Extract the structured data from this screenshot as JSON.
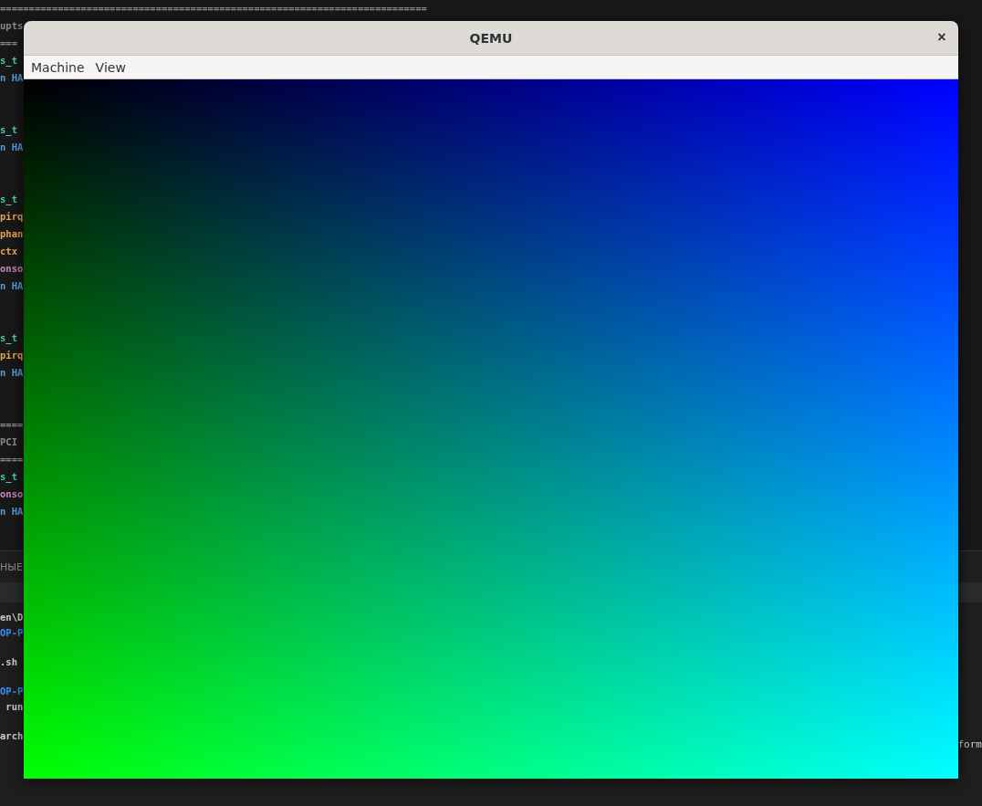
{
  "editor": {
    "groups": [
      [
        {
          "text": "==========================================================================",
          "color": "#8a8a8a"
        },
        {
          "text": "upts",
          "color": "#8a8a8a"
        },
        {
          "text": "===",
          "color": "#8a8a8a"
        },
        {
          "text": "s_t",
          "color": "#4ec9b0"
        },
        {
          "text": "n HA",
          "color": "#569cd6"
        }
      ],
      [
        {
          "text": "s_t",
          "color": "#4ec9b0"
        },
        {
          "text": "n HA",
          "color": "#569cd6"
        }
      ],
      [
        {
          "text": "s_t",
          "color": "#4ec9b0"
        },
        {
          "text": "pirq",
          "color": "#e5a15a"
        },
        {
          "text": "phan",
          "color": "#e5a15a"
        },
        {
          "text": "ctx",
          "color": "#e5a15a"
        },
        {
          "text": "onso",
          "color": "#c586c0"
        },
        {
          "text": "n HA",
          "color": "#569cd6"
        }
      ],
      [
        {
          "text": "s_t",
          "color": "#4ec9b0"
        },
        {
          "text": "pirq",
          "color": "#e5a15a"
        },
        {
          "text": "n HA",
          "color": "#569cd6"
        }
      ],
      [
        {
          "text": "====",
          "color": "#8a8a8a"
        },
        {
          "text": "PCI",
          "color": "#8a8a8a"
        },
        {
          "text": "====",
          "color": "#8a8a8a"
        },
        {
          "text": "s_t",
          "color": "#4ec9b0"
        },
        {
          "text": "onso",
          "color": "#c586c0"
        },
        {
          "text": "n HA",
          "color": "#569cd6"
        }
      ]
    ]
  },
  "panel": {
    "title": "НЫЕ",
    "terminal_groups": [
      [
        {
          "text": "en\\D",
          "color": "#cccccc"
        },
        {
          "text": "OP-P",
          "color": "#3b8eea"
        }
      ],
      [
        {
          "text": ".sh",
          "color": "#cccccc"
        }
      ],
      [
        {
          "text": "OP-P",
          "color": "#3b8eea"
        },
        {
          "text": " run",
          "color": "#cccccc"
        }
      ],
      [
        {
          "text": "arch",
          "color": "#cccccc"
        }
      ]
    ],
    "right_text": "form"
  },
  "window": {
    "title": "QEMU",
    "close": "×",
    "menus": [
      "Machine",
      "View"
    ]
  }
}
